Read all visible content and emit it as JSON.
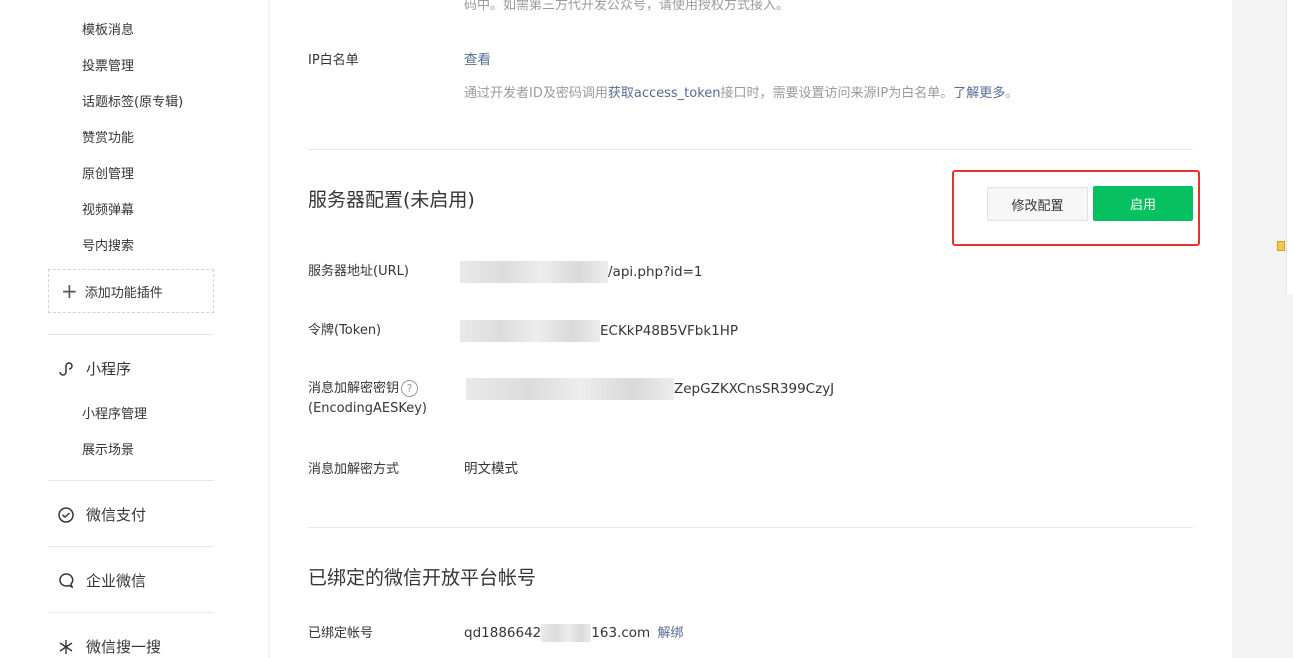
{
  "sidebar": {
    "sub_items": [
      "模板消息",
      "投票管理",
      "话题标签(原专辑)",
      "赞赏功能",
      "原创管理",
      "视频弹幕",
      "号内搜索"
    ],
    "add_plugin_label": "添加功能插件",
    "groups": [
      {
        "label": "小程序",
        "icon": "mini-program-icon"
      },
      {
        "label": "微信支付",
        "icon": "wechat-pay-icon"
      },
      {
        "label": "企业微信",
        "icon": "work-wechat-icon"
      },
      {
        "label": "微信搜一搜",
        "icon": "wechat-search-icon"
      }
    ],
    "mini_program_items": [
      "小程序管理",
      "展示场景"
    ]
  },
  "top_truncated_text": "码中。如需第三方代开发公众号，请使用授权方式接入。",
  "ip_whitelist": {
    "label": "IP白名单",
    "view_link": "查看",
    "tip_prefix": "通过开发者ID及密码调用",
    "tip_link": "获取access_token",
    "tip_middle": "接口时，需要设置访问来源IP为白名单。",
    "tip_more": "了解更多",
    "tip_end": "。"
  },
  "server_config": {
    "title": "服务器配置(未启用)",
    "modify_button": "修改配置",
    "enable_button": "启用",
    "url_label": "服务器地址(URL)",
    "url_value": "/api.php?id=1",
    "token_label": "令牌(Token)",
    "token_value": "ECKkP48B5VFbk1HP",
    "aes_label_line1": "消息加解密密钥",
    "aes_label_line2": "(EncodingAESKey)",
    "aes_value": "ZepGZKXCnsSR399CzyJ",
    "mode_label": "消息加解密方式",
    "mode_value": "明文模式"
  },
  "open_platform": {
    "title": "已绑定的微信开放平台帐号",
    "account_label": "已绑定帐号",
    "account_prefix": "qd1886642",
    "account_suffix": "163.com",
    "unbind_link": "解绑"
  },
  "colors": {
    "primary": "#07c160",
    "link": "#576b95",
    "highlight": "#e4332c"
  }
}
